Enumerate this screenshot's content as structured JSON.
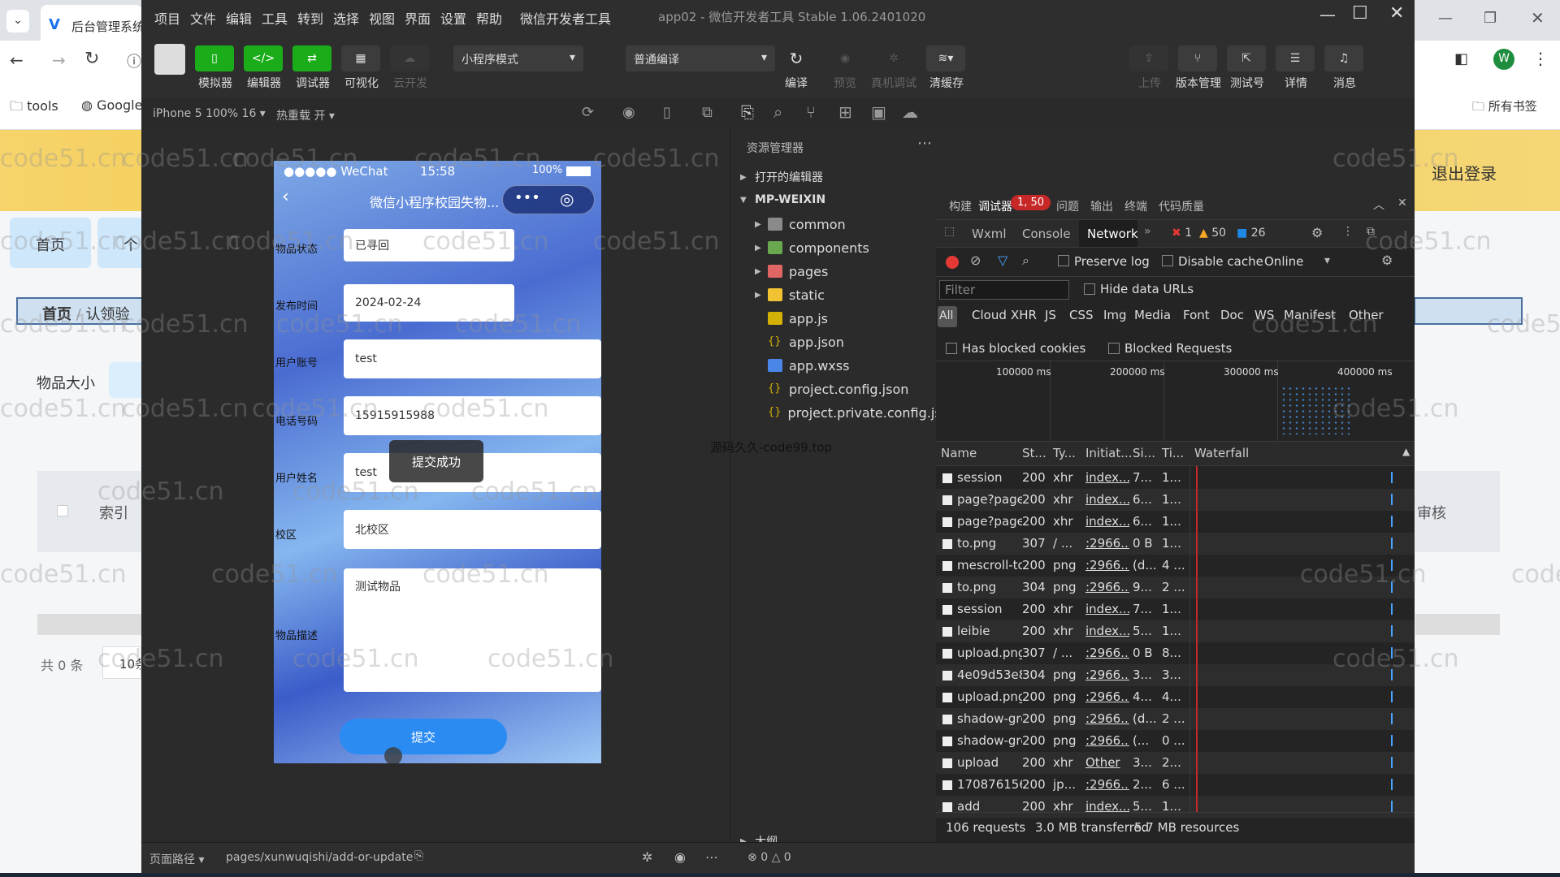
{
  "browser": {
    "tab_title": "后台管理系统",
    "bookmarks": [
      "tools",
      "Google",
      "所有书签"
    ],
    "profile_initial": "W"
  },
  "background_page": {
    "logout": "退出登录",
    "home_btn": "首页",
    "tab_partial": "个",
    "breadcrumb_home": "首页",
    "breadcrumb_current": "认领验",
    "filter_label": "物品大小",
    "table_col_index": "索引",
    "table_col_review": "审核",
    "total": "共 0 条",
    "page_size": "10条"
  },
  "ide": {
    "title": "app02 - 微信开发者工具 Stable 1.06.2401020",
    "menu": [
      "项目",
      "文件",
      "编辑",
      "工具",
      "转到",
      "选择",
      "视图",
      "界面",
      "设置",
      "帮助",
      "微信开发者工具"
    ],
    "toolbar": {
      "simulator": "模拟器",
      "editor": "编辑器",
      "debugger": "调试器",
      "visual": "可视化",
      "cloud": "云开发",
      "mode": "小程序模式",
      "compile_mode": "普通编译",
      "compile": "编译",
      "preview": "预览",
      "remote_debug": "真机调试",
      "clear_cache": "清缓存",
      "upload": "上传",
      "version": "版本管理",
      "test_account": "测试号",
      "details": "详情",
      "messages": "消息"
    },
    "device": "iPhone 5 100% 16",
    "hot_reload": "热重载 开",
    "page_path_label": "页面路径",
    "page_path": "pages/xunwuqishi/add-or-update",
    "outline": "大纲",
    "errors_count": "0",
    "warnings_count": "0",
    "code_watermark": "源码久久-code99.top"
  },
  "phone": {
    "carrier": "●●●●● WeChat",
    "time": "15:58",
    "battery": "100%",
    "nav_title": "微信小程序校园失物...",
    "form": [
      {
        "label": "物品状态",
        "value": "已寻回"
      },
      {
        "label": "发布时间",
        "value": "2024-02-24"
      },
      {
        "label": "用户账号",
        "value": "test"
      },
      {
        "label": "电话号码",
        "value": "15915915988"
      },
      {
        "label": "用户姓名",
        "value": "test"
      },
      {
        "label": "校区",
        "value": "北校区"
      },
      {
        "label": "物品描述",
        "value": "测试物品"
      }
    ],
    "toast": "提交成功",
    "submit": "提交"
  },
  "explorer": {
    "title": "资源管理器",
    "open_editors": "打开的编辑器",
    "root": "MP-WEIXIN",
    "items": [
      {
        "name": "common",
        "type": "folder"
      },
      {
        "name": "components",
        "type": "folder"
      },
      {
        "name": "pages",
        "type": "folder"
      },
      {
        "name": "static",
        "type": "folder"
      },
      {
        "name": "app.js",
        "type": "js"
      },
      {
        "name": "app.json",
        "type": "json"
      },
      {
        "name": "app.wxss",
        "type": "wxss"
      },
      {
        "name": "project.config.json",
        "type": "json"
      },
      {
        "name": "project.private.config.js...",
        "type": "json"
      }
    ]
  },
  "devtools": {
    "top_tabs": [
      "构建",
      "调试器",
      "问题",
      "输出",
      "终端",
      "代码质量"
    ],
    "debugger_badge": "1, 50",
    "panel_tabs": [
      "Wxml",
      "Console",
      "Network"
    ],
    "error_count": "1",
    "warning_count": "50",
    "info_count": "26",
    "preserve_log": "Preserve log",
    "disable_cache": "Disable cache",
    "throttle": "Online",
    "filter_placeholder": "Filter",
    "hide_data_urls": "Hide data URLs",
    "types": [
      "All",
      "Cloud",
      "XHR",
      "JS",
      "CSS",
      "Img",
      "Media",
      "Font",
      "Doc",
      "WS",
      "Manifest",
      "Other"
    ],
    "has_blocked_cookies": "Has blocked cookies",
    "blocked_requests": "Blocked Requests",
    "timeline_ticks": [
      "100000 ms",
      "200000 ms",
      "300000 ms",
      "400000 ms"
    ],
    "columns": [
      "Name",
      "St...",
      "Ty...",
      "Initiat...",
      "Si...",
      "Ti...",
      "Waterfall"
    ],
    "rows": [
      [
        "session",
        "200",
        "xhr",
        "index...",
        "7...",
        "1..."
      ],
      [
        "page?page...",
        "200",
        "xhr",
        "index...",
        "6...",
        "1..."
      ],
      [
        "page?page...",
        "200",
        "xhr",
        "index...",
        "6...",
        "1..."
      ],
      [
        "to.png",
        "307",
        "/ ...",
        ":2966...",
        "0 B",
        "1..."
      ],
      [
        "mescroll-to...",
        "200",
        "png",
        ":2966...",
        "(d...",
        "4 ..."
      ],
      [
        "to.png",
        "304",
        "png",
        ":2966...",
        "9...",
        "2 ..."
      ],
      [
        "session",
        "200",
        "xhr",
        "index...",
        "7...",
        "1..."
      ],
      [
        "leibie",
        "200",
        "xhr",
        "index...",
        "5...",
        "1..."
      ],
      [
        "upload.png",
        "307",
        "/ ...",
        ":2966...",
        "0 B",
        "8..."
      ],
      [
        "4e09d53e8f...",
        "304",
        "png",
        ":2966...",
        "3...",
        "3..."
      ],
      [
        "upload.png",
        "200",
        "png",
        ":2966...",
        "4...",
        "4..."
      ],
      [
        "shadow-gre...",
        "200",
        "png",
        ":2966...",
        "(d...",
        "2 ..."
      ],
      [
        "shadow-gre...",
        "200",
        "png",
        ":2966...",
        "(...",
        "0 ..."
      ],
      [
        "upload",
        "200",
        "xhr",
        "Other",
        "3...",
        "2..."
      ],
      [
        "170876156...",
        "200",
        "jp...",
        ":2966...",
        "2...",
        "6 ..."
      ],
      [
        "add",
        "200",
        "xhr",
        "index...",
        "5...",
        "1..."
      ]
    ],
    "summary_requests": "106 requests",
    "summary_transferred": "3.0 MB transferred",
    "summary_resources": "5.7 MB resources"
  },
  "watermark": "code51.cn",
  "colors": {
    "accent_green": "#1aad19",
    "link_blue": "#2a8bf2",
    "error_red": "#e53935"
  }
}
